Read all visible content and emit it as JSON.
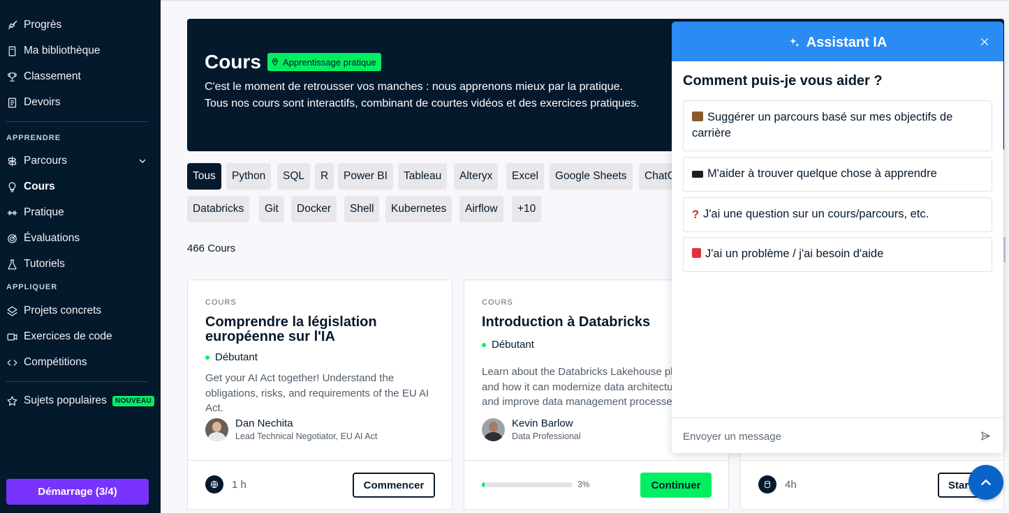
{
  "sidebar": {
    "items_top": [
      {
        "label": "Progrès",
        "icon": "rocket-icon"
      },
      {
        "label": "Ma bibliothèque",
        "icon": "bookmark-icon"
      },
      {
        "label": "Classement",
        "icon": "trophy-icon"
      },
      {
        "label": "Devoirs",
        "icon": "list-icon"
      }
    ],
    "section_learn": "APPRENDRE",
    "items_learn": [
      {
        "label": "Parcours",
        "icon": "signpost-icon"
      },
      {
        "label": "Cours",
        "icon": "lightbulb-icon"
      },
      {
        "label": "Pratique",
        "icon": "dumbbell-icon"
      },
      {
        "label": "Évaluations",
        "icon": "target-icon"
      },
      {
        "label": "Tutoriels",
        "icon": "flask-icon"
      }
    ],
    "section_apply": "APPLIQUER",
    "items_apply": [
      {
        "label": "Projets concrets",
        "icon": "layers-icon"
      },
      {
        "label": "Exercices de code",
        "icon": "video-icon"
      },
      {
        "label": "Compétitions",
        "icon": "code-icon"
      }
    ],
    "popular": {
      "label": "Sujets populaires",
      "badge": "NOUVEAU",
      "icon": "star-icon"
    },
    "start_button": "Démarrage (3/4)"
  },
  "hero": {
    "title": "Cours",
    "badge": "Apprentissage pratique",
    "line1": "C'est le moment de retrousser vos manches : nous apprenons mieux par la pratique.",
    "line2": "Tous nos cours sont interactifs, combinant de courtes vidéos et des exercices pratiques."
  },
  "filters_row1": [
    "Tous",
    "Python",
    "SQL",
    "R",
    "Power BI",
    "Tableau",
    "Alteryx",
    "Excel",
    "Google Sheets",
    "ChatGPT"
  ],
  "filters_row2": [
    "Databricks",
    "Git",
    "Docker",
    "Shell",
    "Kubernetes",
    "Airflow",
    "+10"
  ],
  "count": "466 Cours",
  "cards": [
    {
      "kicker": "COURS",
      "title": "Comprendre la législation européenne sur l'IA",
      "level": "Débutant",
      "desc": "Get your AI Act together! Understand the obligations, risks, and requirements of the EU AI Act.",
      "author": "Dan Nechita",
      "role": "Lead Technical Negotiator, EU AI Act",
      "duration": "1 h",
      "button": "Commencer"
    },
    {
      "kicker": "COURS",
      "title": "Introduction à Databricks",
      "level": "Débutant",
      "desc": "Learn about the Databricks Lakehouse platform and how it can modernize data architecture and improve data management processes.",
      "author": "Kevin Barlow",
      "role": "Data Professional",
      "progress": 3,
      "progress_label": "3%",
      "button": "Continuer"
    },
    {
      "duration": "4h",
      "button": "Start"
    }
  ],
  "assistant": {
    "title": "Assistant IA",
    "question": "Comment puis-je vous aider ?",
    "options": [
      "Suggérer un parcours basé sur mes objectifs de carrière",
      "M'aider à trouver quelque chose à apprendre",
      "J'ai une question sur un cours/parcours, etc.",
      "J'ai un problème / j'ai besoin d'aide"
    ],
    "placeholder": "Envoyer un message"
  },
  "colors": {
    "navy": "#05192d",
    "green": "#03ef62",
    "purple": "#7933ff",
    "blue": "#2a8bf2"
  }
}
